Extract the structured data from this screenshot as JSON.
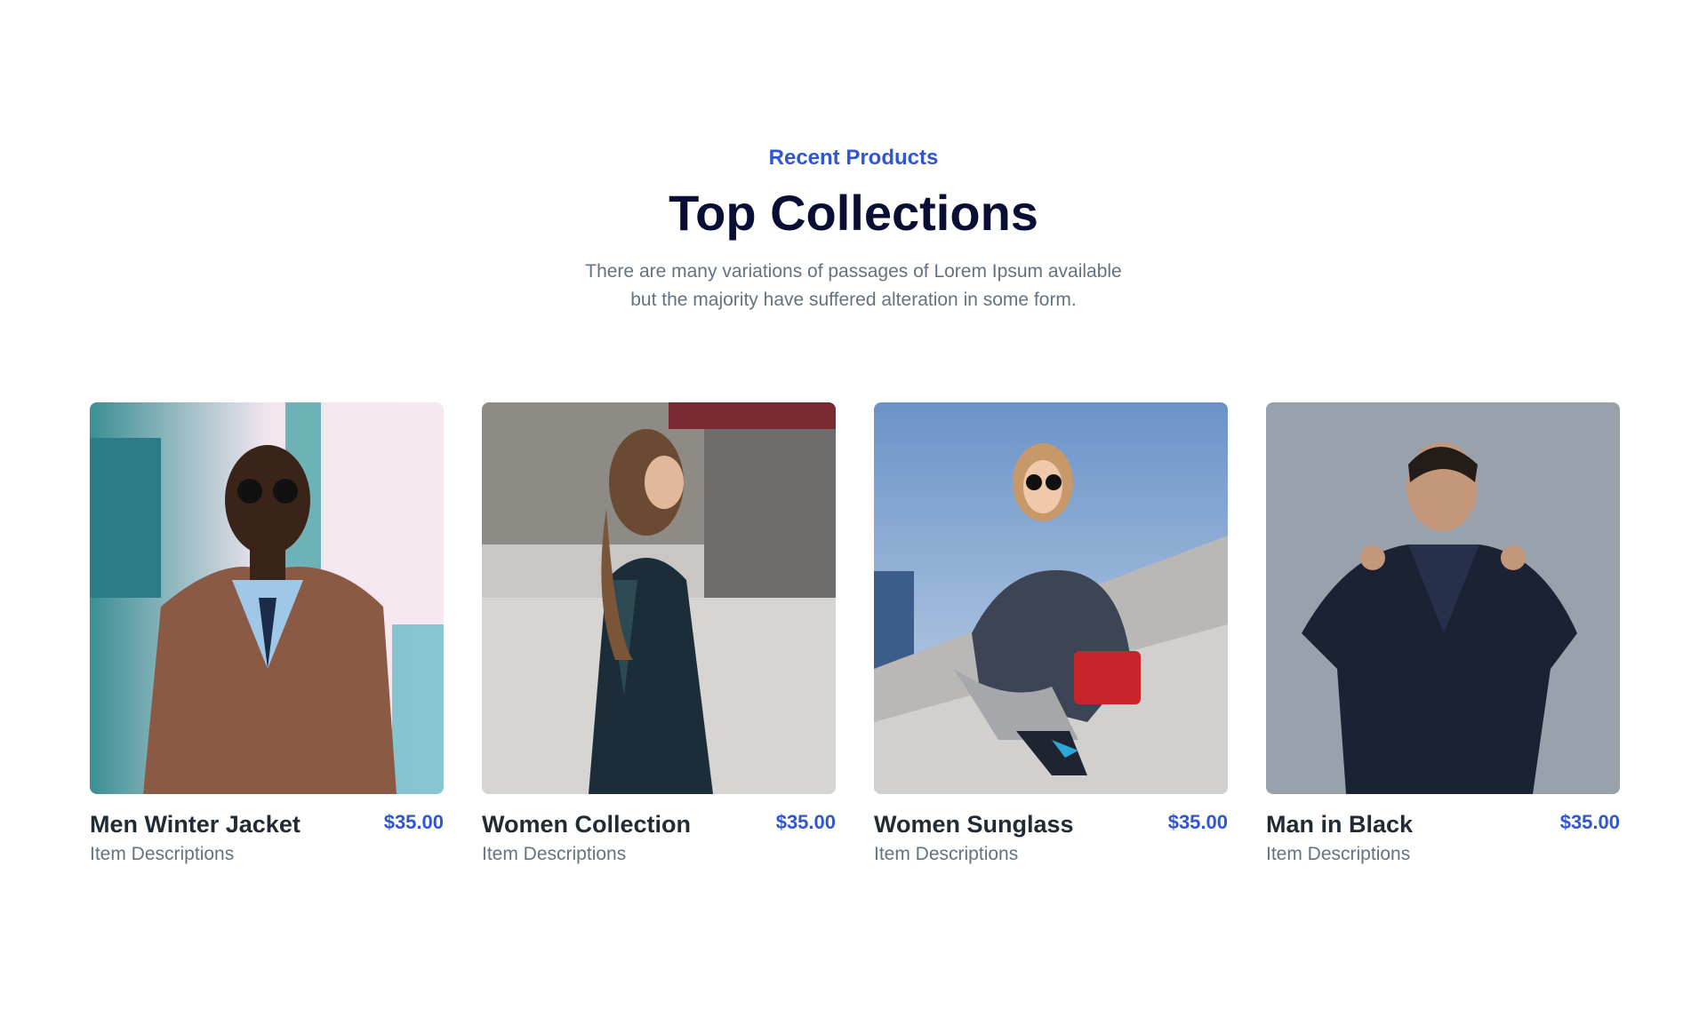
{
  "section": {
    "eyebrow": "Recent Products",
    "title": "Top Collections",
    "description_line1": "There are many variations of passages of Lorem Ipsum available",
    "description_line2": "but the majority have suffered alteration in some form."
  },
  "products": [
    {
      "name": "Men Winter Jacket",
      "price": "$35.00",
      "description": "Item Descriptions",
      "image": "man-brown-leather-jacket-photo"
    },
    {
      "name": "Women Collection",
      "price": "$35.00",
      "description": "Item Descriptions",
      "image": "woman-plaid-coat-street-photo"
    },
    {
      "name": "Women Sunglass",
      "price": "$35.00",
      "description": "Item Descriptions",
      "image": "woman-sunglasses-stairs-photo"
    },
    {
      "name": "Man in Black",
      "price": "$35.00",
      "description": "Item Descriptions",
      "image": "man-black-shirt-photo"
    }
  ],
  "colors": {
    "accent": "#3056d3",
    "heading": "#090e34",
    "body_text": "#637381",
    "product_name": "#212b36"
  }
}
